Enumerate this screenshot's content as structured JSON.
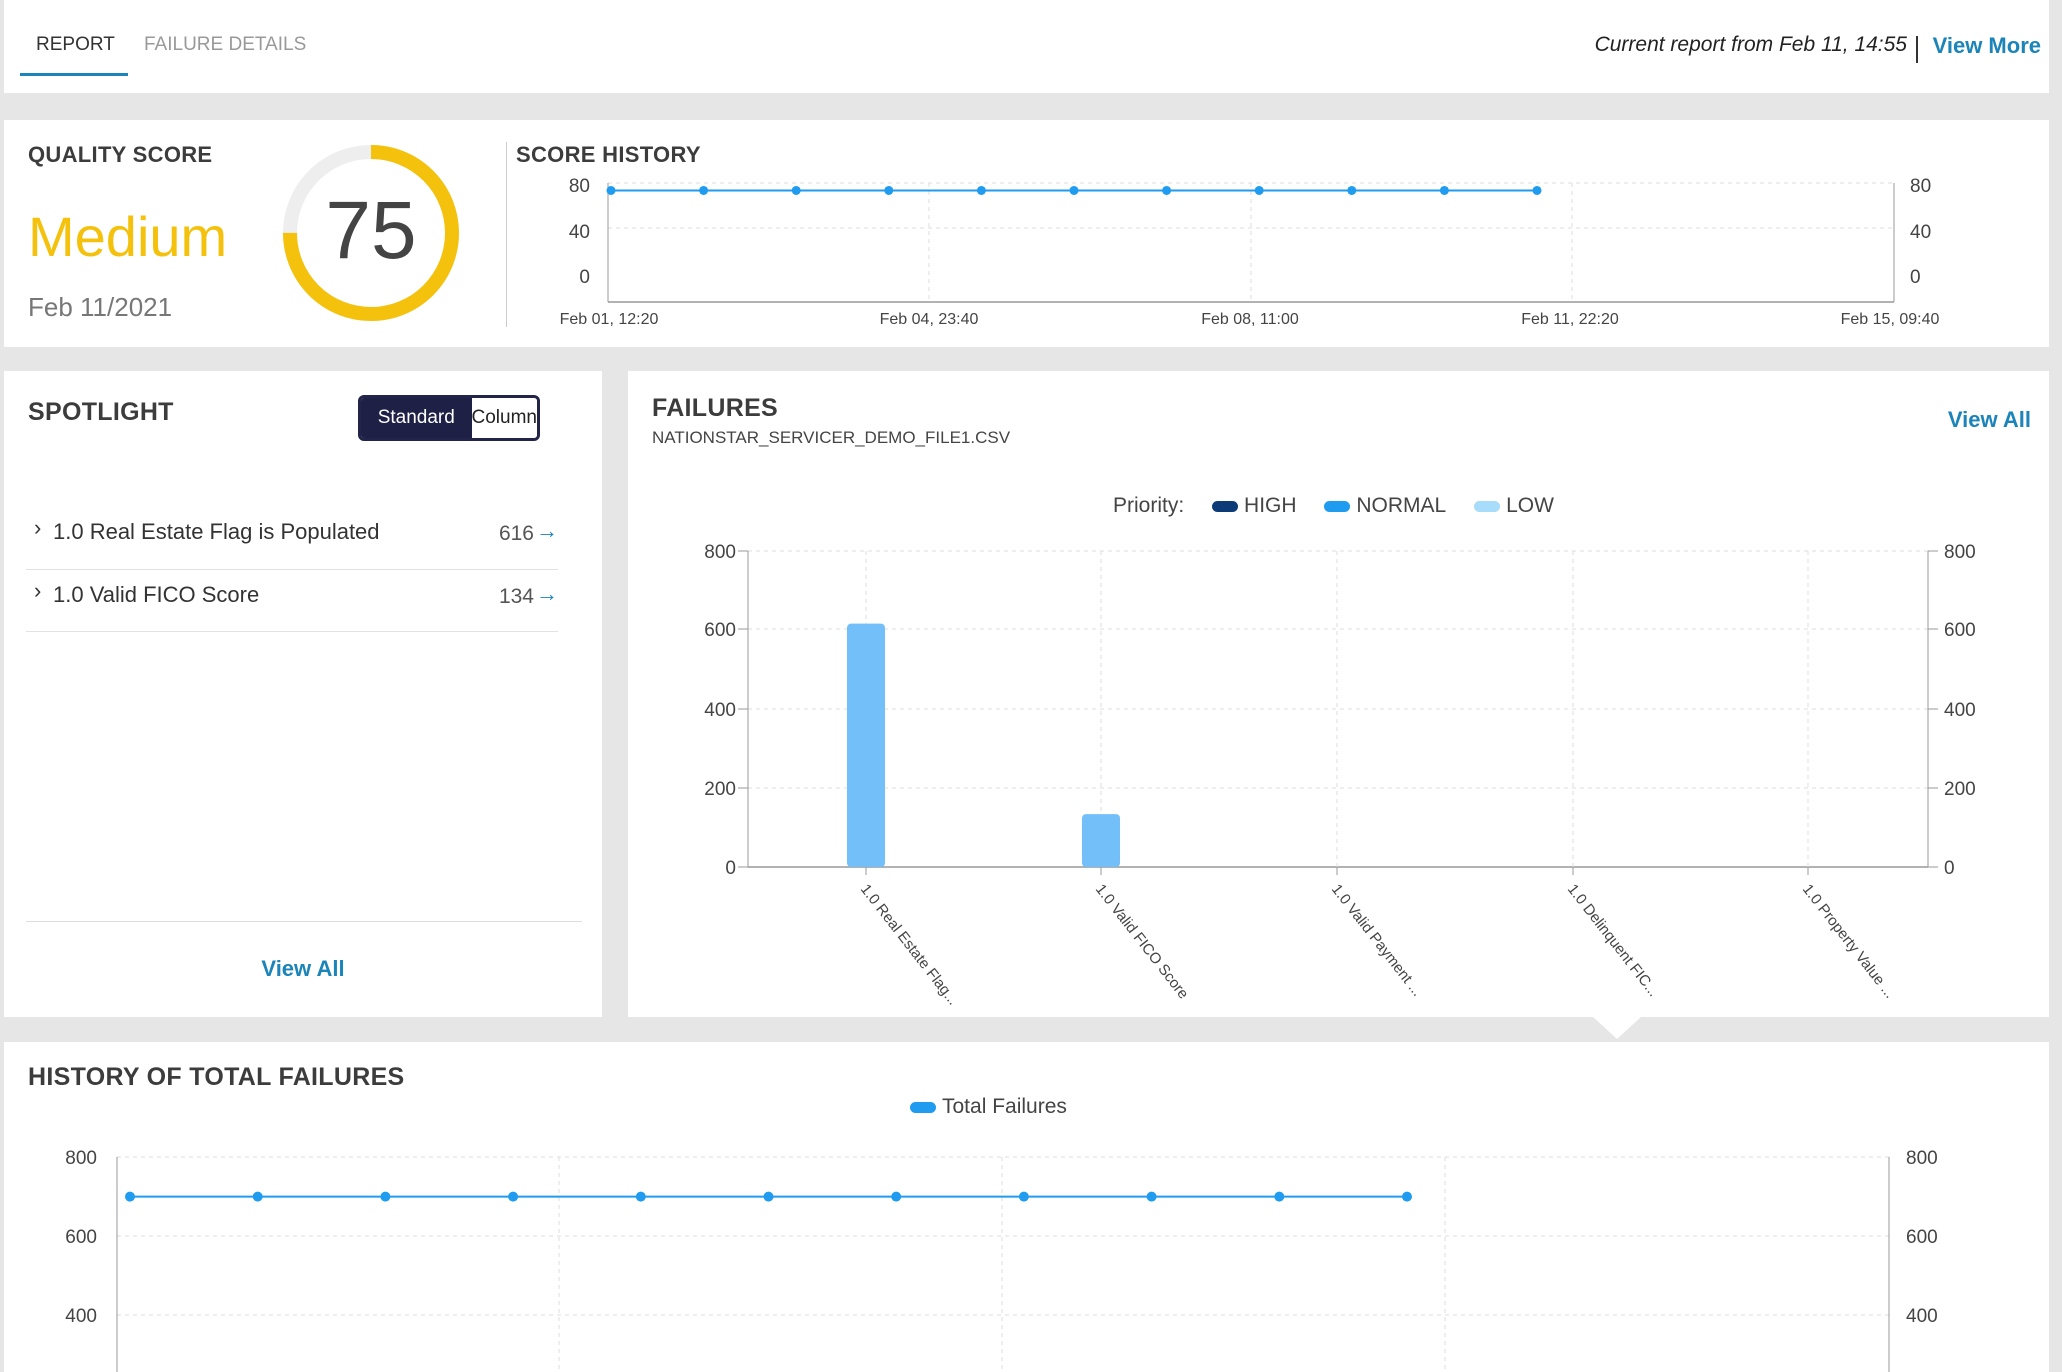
{
  "tabs": [
    {
      "label": "REPORT",
      "active": true
    },
    {
      "label": "FAILURE DETAILS",
      "active": false
    }
  ],
  "header": {
    "report_text": "Current report from Feb 11, 14:55",
    "view_more": "View More"
  },
  "quality": {
    "title": "QUALITY SCORE",
    "level": "Medium",
    "date": "Feb 11/2021",
    "score": "75",
    "score_fraction": 0.75,
    "accent": "#f4c20d"
  },
  "score_history": {
    "title": "SCORE HISTORY",
    "yticks": [
      "80",
      "40",
      "0"
    ],
    "xticks": [
      "Feb 01, 12:20",
      "Feb 04, 23:40",
      "Feb 08, 11:00",
      "Feb 11, 22:20",
      "Feb 15, 09:40"
    ]
  },
  "spotlight": {
    "title": "SPOTLIGHT",
    "toggle": [
      "Standard",
      "Column"
    ],
    "items": [
      {
        "label": "1.0 Real Estate Flag is Populated",
        "count": "616"
      },
      {
        "label": "1.0 Valid FICO Score",
        "count": "134"
      }
    ],
    "view_all": "View All"
  },
  "failures": {
    "title": "FAILURES",
    "file": "NATIONSTAR_SERVICER_DEMO_FILE1.CSV",
    "view_all": "View All",
    "priority_label": "Priority:",
    "legend": [
      {
        "label": "HIGH",
        "color": "#0d3b78"
      },
      {
        "label": "NORMAL",
        "color": "#1f9bef"
      },
      {
        "label": "LOW",
        "color": "#a8dcfb"
      }
    ],
    "yticks": [
      "800",
      "600",
      "400",
      "200",
      "0"
    ]
  },
  "history": {
    "title": "HISTORY OF TOTAL FAILURES",
    "legend": "Total Failures",
    "yticks": [
      "800",
      "600",
      "400"
    ]
  },
  "chart_data": [
    {
      "type": "line",
      "name": "score_history",
      "title": "SCORE HISTORY",
      "x": [
        "Feb 01, 12:20",
        "Feb 02, 11:20",
        "Feb 03, 10:20",
        "Feb 04, 09:20",
        "Feb 05, 08:20",
        "Feb 06, 07:20",
        "Feb 07, 06:20",
        "Feb 08, 05:20",
        "Feb 09, 04:20",
        "Feb 10, 03:20",
        "Feb 11, 02:20"
      ],
      "series": [
        {
          "values": [
            75,
            75,
            75,
            75,
            75,
            75,
            75,
            75,
            75,
            75,
            75
          ]
        }
      ],
      "ylim": [
        0,
        80
      ],
      "color": "#1f9bef",
      "grid": true
    },
    {
      "type": "bar",
      "name": "failures",
      "title": "FAILURES",
      "categories": [
        "1.0 Real Estate Flag...",
        "1.0 Valid FICO Score",
        "1.0 Valid Payment ...",
        "1.0 Delinquent FIC...",
        "1.0 Property Value ..."
      ],
      "series": [
        {
          "name": "NORMAL",
          "values": [
            616,
            134,
            0,
            0,
            0
          ]
        }
      ],
      "ylim": [
        0,
        800
      ],
      "color": "#72bffa",
      "grid": true
    },
    {
      "type": "line",
      "name": "total_failures",
      "title": "HISTORY OF TOTAL FAILURES",
      "series": [
        {
          "name": "Total Failures",
          "values": [
            750,
            750,
            750,
            750,
            750,
            750,
            750,
            750,
            750,
            750,
            750
          ]
        }
      ],
      "ylim": [
        400,
        800
      ],
      "color": "#1f9bef",
      "grid": true
    }
  ]
}
